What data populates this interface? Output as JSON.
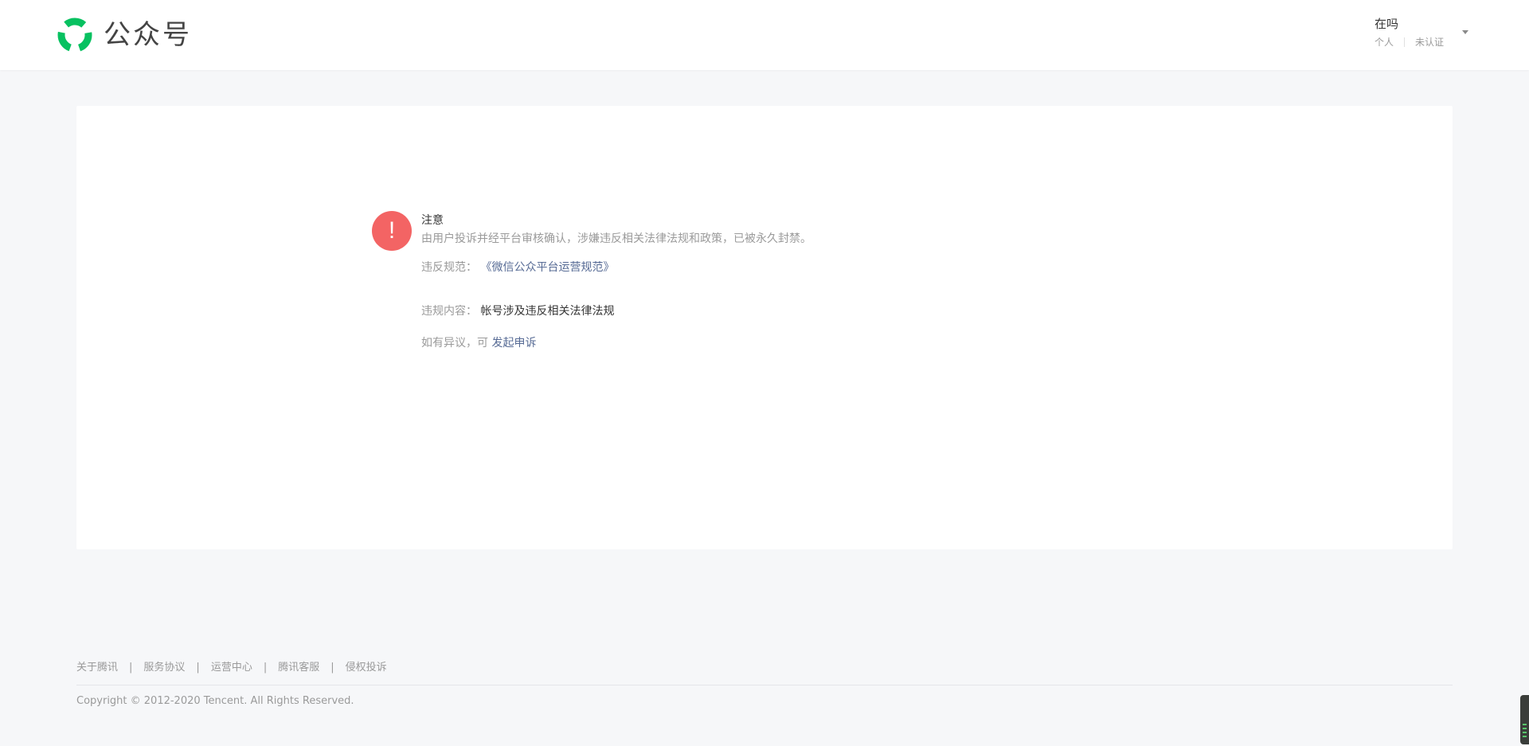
{
  "header": {
    "logo_text": "公众号",
    "account_name": "在吗",
    "account_type": "个人",
    "verify_status": "未认证"
  },
  "notice": {
    "title": "注意",
    "description": "由用户投诉并经平台审核确认，涉嫌违反相关法律法规和政策，已被永久封禁。",
    "rule_label": "违反规范：",
    "rule_link": "《微信公众平台运营规范》",
    "content_label": "违规内容：",
    "content_value": "帐号涉及违反相关法律法规",
    "appeal_prefix": "如有异议，可",
    "appeal_link": "发起申诉"
  },
  "footer": {
    "links": [
      "关于腾讯",
      "服务协议",
      "运营中心",
      "腾讯客服",
      "侵权投诉"
    ],
    "separator": "|",
    "copyright": "Copyright © 2012-2020 Tencent. All Rights Reserved."
  },
  "colors": {
    "brand_green": "#07c160",
    "warning_red": "#f36464",
    "link_blue": "#576b95",
    "page_bg": "#f6f7f9"
  },
  "icons": {
    "logo": "wechat-official-account-logo-icon",
    "warning": "exclamation-icon",
    "caret": "caret-down-icon"
  }
}
